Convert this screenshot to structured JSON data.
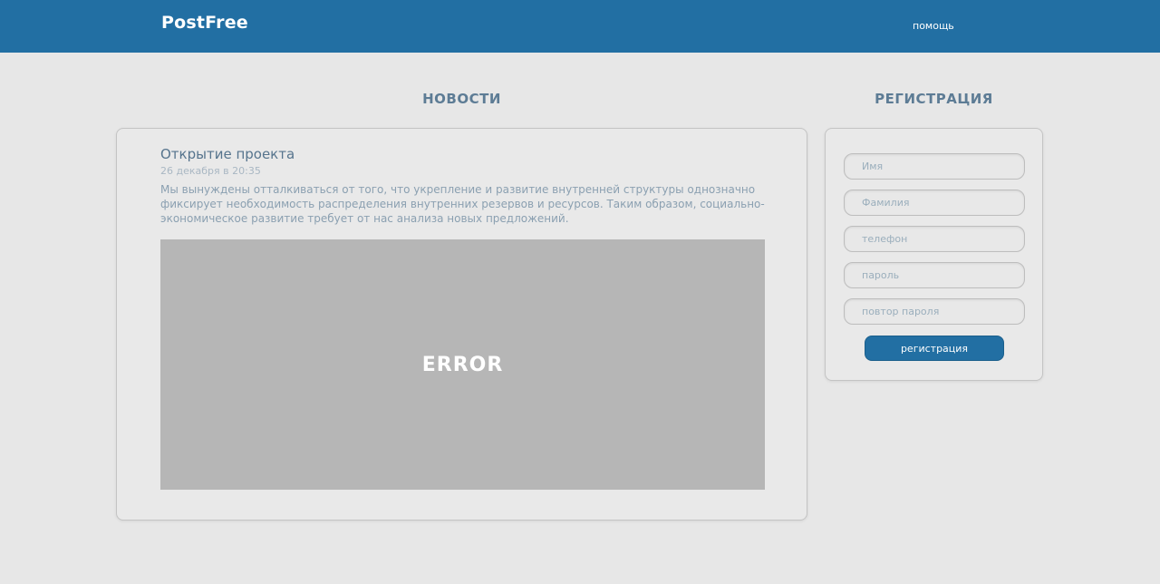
{
  "header": {
    "logo": "PostFree",
    "help_link": "помощь"
  },
  "news": {
    "section_title": "НОВОСТИ",
    "post": {
      "title": "Открытие проекта",
      "date": "26 декабря в 20:35",
      "text": "Мы вынуждены отталкиваться от того, что укрепление и развитие внутренней структуры однозначно фиксирует необходимость распределения внутренних резервов и ресурсов. Таким образом, социально-экономическое раз­витие требует от нас анализа новых предложений.",
      "image_text": "ERROR"
    }
  },
  "registration": {
    "section_title": "РЕГИСТРАЦИЯ",
    "fields": {
      "first_name": "Имя",
      "last_name": "Фамилия",
      "phone": "телефон",
      "password": "пароль",
      "password_repeat": "повтор пароля"
    },
    "submit_label": "регистрация"
  },
  "colors": {
    "brand": "#226fa3",
    "background": "#e7e7e7",
    "heading": "#5d7c95"
  }
}
